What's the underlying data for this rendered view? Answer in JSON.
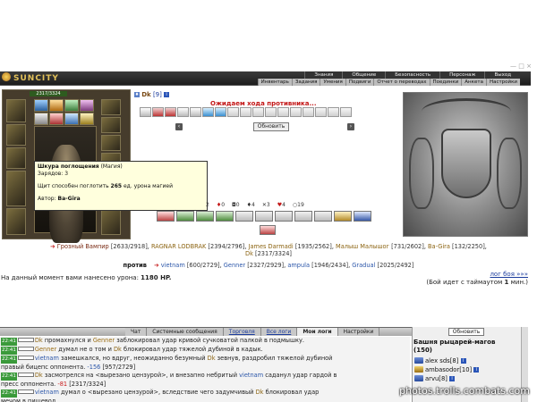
{
  "app": {
    "logo_text": "SUNCITY",
    "top_menu": [
      "Знания",
      "Общение",
      "Безопасность",
      "Персонаж",
      "Выход"
    ],
    "sub_menu": [
      "Инвентарь",
      "Задания",
      "Умения",
      "Подвиги",
      "Отчет о переводах",
      "Поединки",
      "Анкета",
      "Настройки"
    ]
  },
  "character": {
    "hp": "2317/3324"
  },
  "tooltip": {
    "title": "Шкура поглощения",
    "type": "(Магия)",
    "charges": "Зарядов: 3",
    "description_pre": "Щит способен поглотить ",
    "description_value": "265",
    "description_post": " ед. урона магией",
    "author_label": "Автор: ",
    "author": "Ba-Gira"
  },
  "battle": {
    "player_name": "Dk",
    "player_level": "[9]",
    "waiting_text": "Ожидаем хода противника...",
    "refresh_label": "Обновить",
    "counters": [
      "2",
      "0",
      "0",
      "4",
      "3",
      "4",
      "19"
    ]
  },
  "team_allies": [
    {
      "name": "Грозный Вампир",
      "hp": "[2633/2918]"
    },
    {
      "name": "RAGNAR LODBRAK",
      "hp": "[2394/2796]"
    },
    {
      "name": "James Darmadi",
      "hp": "[1935/2562]"
    },
    {
      "name": "Малыш Малышог",
      "hp": "[731/2602]"
    },
    {
      "name": "Ba-Gira",
      "hp": "[132/2250]"
    },
    {
      "name": "Dk",
      "hp": "[2317/3324]"
    }
  ],
  "team_enemies": {
    "label": "против",
    "list": [
      {
        "name": "vietnam",
        "hp": "[600/2729]"
      },
      {
        "name": "Genner",
        "hp": "[2327/2929]"
      },
      {
        "name": "ampula",
        "hp": "[1946/2434]"
      },
      {
        "name": "Gradual",
        "hp": "[2025/2492]"
      }
    ]
  },
  "damage": {
    "text": "На данный момент вами нанесено урона: ",
    "value": "1180 HP."
  },
  "battle_log_link": "лог боя »»»",
  "timeout": {
    "text": "(Бой идет с таймаутом ",
    "value": "1",
    "suffix": " мин.)"
  },
  "chat_tabs": [
    {
      "label": "Чат",
      "kind": "normal"
    },
    {
      "label": "Системные сообщения",
      "kind": "normal"
    },
    {
      "label": "Торговля",
      "kind": "link"
    },
    {
      "label": "Все логи",
      "kind": "link"
    },
    {
      "label": "Мои логи",
      "kind": "active"
    },
    {
      "label": "Настройки",
      "kind": "normal"
    }
  ],
  "chat_messages": [
    {
      "time": "22:41",
      "parts": [
        [
          "dk",
          "Dk"
        ],
        [
          "",
          "промахнулся и "
        ],
        [
          "a",
          "Genner"
        ],
        [
          "",
          "заблокировал удар кривой сучковатой палкой в подмышку."
        ]
      ]
    },
    {
      "time": "22:41",
      "parts": [
        [
          "a",
          "Genner"
        ],
        [
          "",
          "думал не о том и "
        ],
        [
          "dk",
          "Dk"
        ],
        [
          "",
          "блокировал удар тяжелой дубиной в кадык."
        ]
      ]
    },
    {
      "time": "22:41",
      "parts": [
        [
          "b",
          "vietnam"
        ],
        [
          "",
          "замешкался, но вдруг, неожиданно безумный "
        ],
        [
          "dk",
          "Dk"
        ],
        [
          "",
          "зевнув, раздробил тяжелой дубиной"
        ]
      ]
    },
    {
      "time": "",
      "parts": [
        [
          "",
          "правый бицепс оппонента. "
        ],
        [
          "b",
          "-156"
        ],
        [
          "",
          " [957/2729]"
        ]
      ]
    },
    {
      "time": "22:41",
      "parts": [
        [
          "dk",
          "Dk"
        ],
        [
          "",
          "засмотрелся на <вырезано цензурой>, и внезапно небритый "
        ],
        [
          "b",
          "vietnam"
        ],
        [
          "",
          "саданул удар гардой в"
        ]
      ]
    },
    {
      "time": "",
      "parts": [
        [
          "",
          "пресс оппонента. "
        ],
        [
          "red",
          "-81"
        ],
        [
          "",
          " [2317/3324]"
        ]
      ]
    },
    {
      "time": "22:41",
      "parts": [
        [
          "b",
          "vietnam"
        ],
        [
          "",
          "думал о <вырезано цензурой>, вследствие чего задумчивый "
        ],
        [
          "dk",
          "Dk"
        ],
        [
          "",
          "блокировал удар"
        ]
      ]
    },
    {
      "time": "",
      "parts": [
        [
          "",
          "мечом в пищевод."
        ]
      ]
    }
  ],
  "sidebar": {
    "update_label": "Обновить",
    "location": "Башня рыцарей-магов",
    "count": "(150)",
    "users": [
      {
        "name": "alex sds",
        "level": "[8]"
      },
      {
        "name": "ambasodor",
        "level": "[10]"
      },
      {
        "name": "arvu",
        "level": "[8]"
      }
    ]
  },
  "watermark": "photos.trolls.combats.com"
}
